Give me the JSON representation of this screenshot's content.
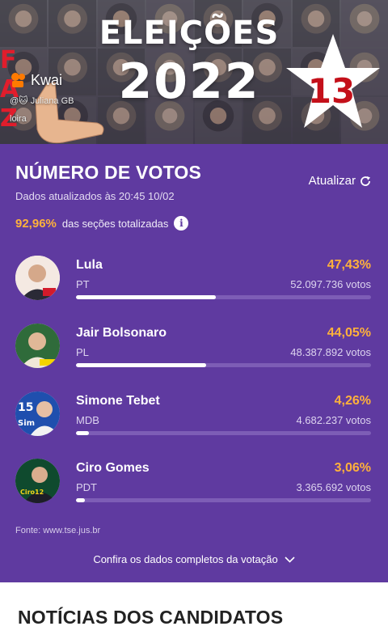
{
  "banner": {
    "title_line1": "ELEIÇÕES",
    "title_line2": "2022",
    "star_number": "13",
    "app_name": "Kwai",
    "app_user": "@🐱 Juliana GB loira",
    "colors": {
      "star_fill": "#ffffff",
      "star_number": "#c4101a"
    }
  },
  "votes": {
    "title": "NÚMERO DE VOTOS",
    "updated_text": "Dados atualizados às 20:45 10/02",
    "refresh_label": "Atualizar",
    "sections_percent": "92,96%",
    "sections_text": "das seções totalizadas",
    "info_icon": "i",
    "candidates": [
      {
        "name": "Lula",
        "party": "PT",
        "percent_text": "47,43%",
        "votes_text": "52.097.736 votos",
        "percent": 47.43
      },
      {
        "name": "Jair Bolsonaro",
        "party": "PL",
        "percent_text": "44,05%",
        "votes_text": "48.387.892 votos",
        "percent": 44.05
      },
      {
        "name": "Simone Tebet",
        "party": "MDB",
        "percent_text": "4,26%",
        "votes_text": "4.682.237 votos",
        "percent": 4.26
      },
      {
        "name": "Ciro Gomes",
        "party": "PDT",
        "percent_text": "3,06%",
        "votes_text": "3.365.692 votos",
        "percent": 3.06
      }
    ],
    "source": "Fonte: www.tse.jus.br",
    "full_data_link": "Confira os dados completos da votação",
    "colors": {
      "card_bg": "#5f3aa0",
      "accent": "#ffb13b",
      "bar_track": "#7d5db6",
      "bar_fill": "#ffffff"
    }
  },
  "news": {
    "title": "NOTÍCIAS DOS CANDIDATOS"
  }
}
